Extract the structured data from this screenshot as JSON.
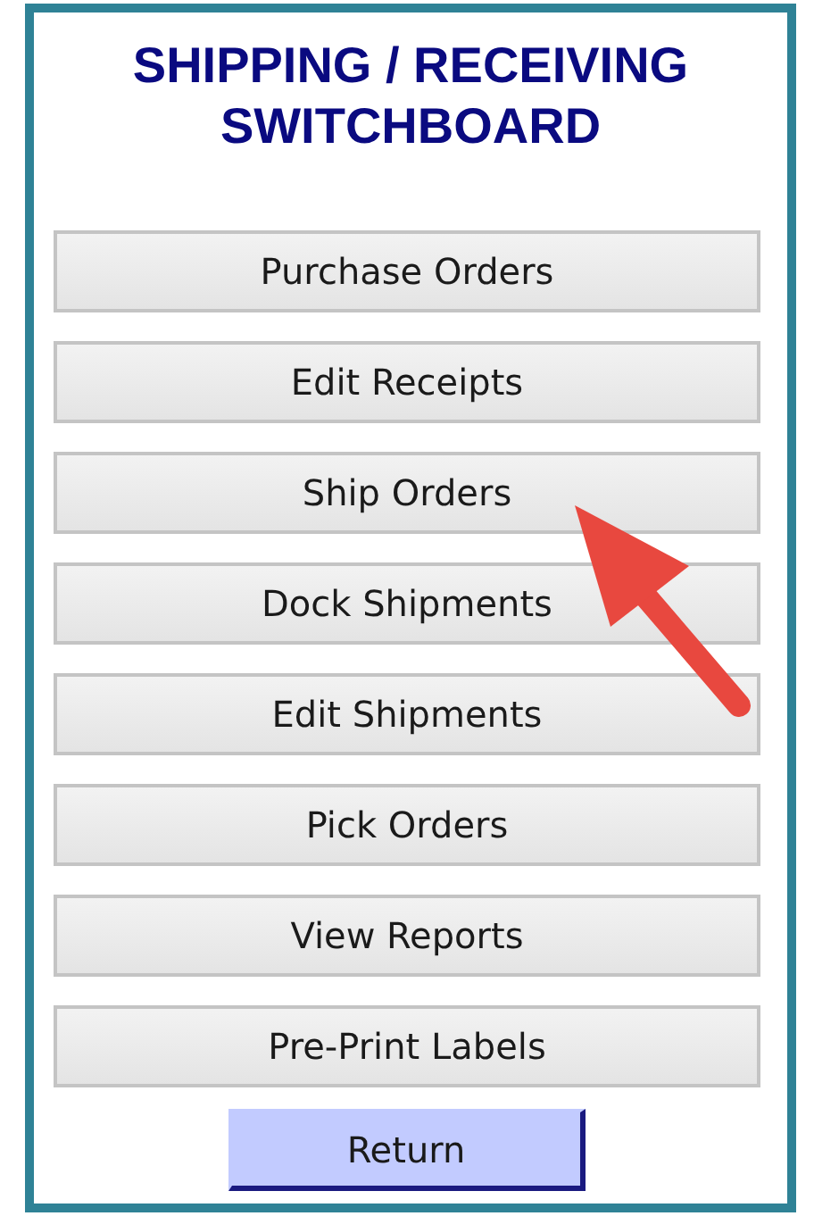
{
  "title": "SHIPPING / RECEIVING SWITCHBOARD",
  "buttons": [
    {
      "label": "Purchase Orders"
    },
    {
      "label": "Edit Receipts"
    },
    {
      "label": "Ship Orders"
    },
    {
      "label": "Dock Shipments"
    },
    {
      "label": "Edit Shipments"
    },
    {
      "label": "Pick Orders"
    },
    {
      "label": "View Reports"
    },
    {
      "label": "Pre-Print Labels"
    }
  ],
  "return_button": {
    "label": "Return"
  }
}
